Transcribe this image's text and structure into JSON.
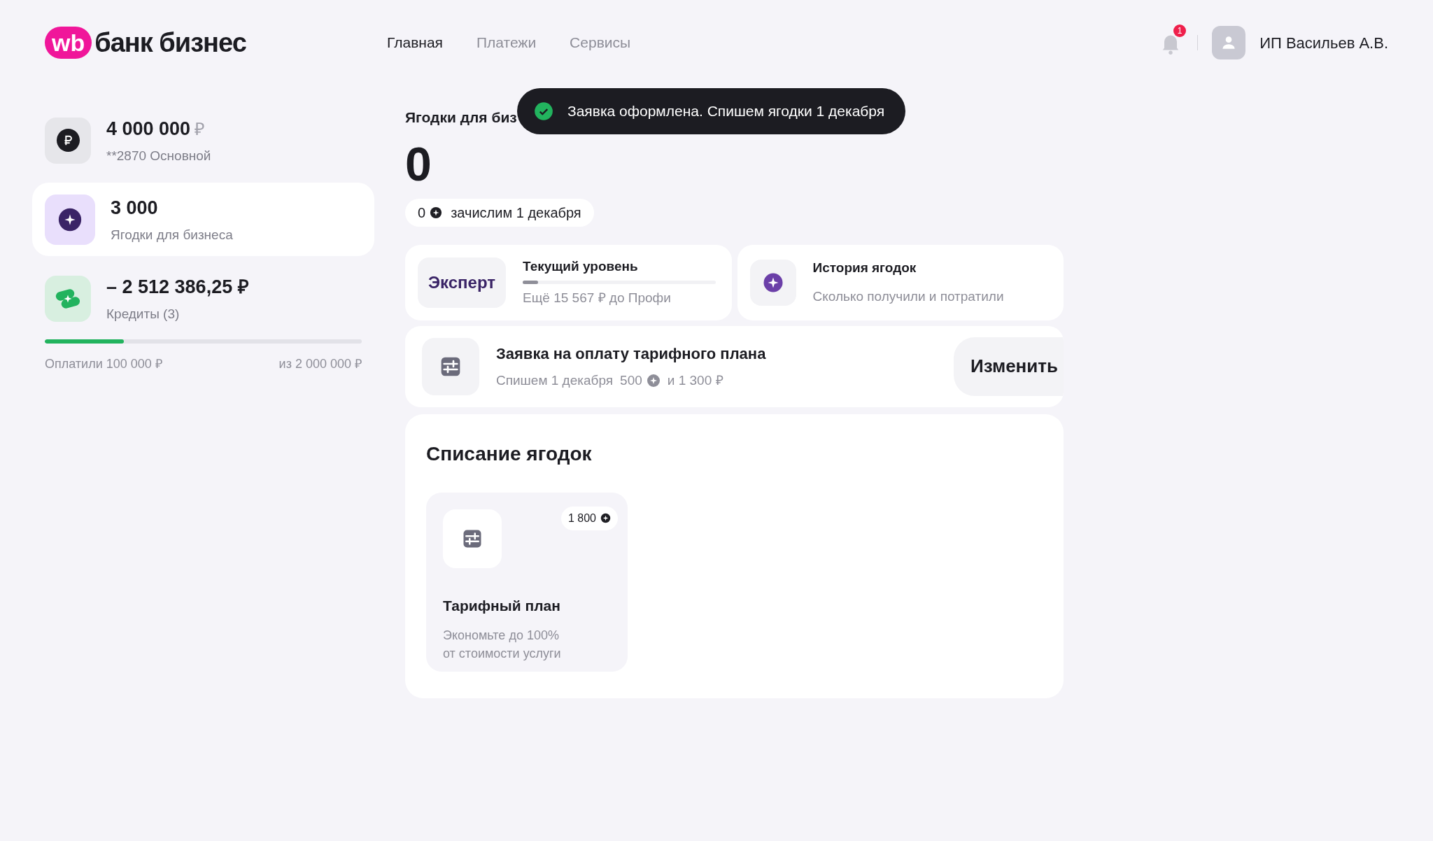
{
  "header": {
    "logo_badge": "wb",
    "logo_text": "банк бизнес",
    "nav": [
      {
        "label": "Главная",
        "selected": true
      },
      {
        "label": "Платежи",
        "selected": false
      },
      {
        "label": "Сервисы",
        "selected": false
      }
    ],
    "notifications": "1",
    "user": "ИП Васильев А.В."
  },
  "sidebar": {
    "accounts": [
      {
        "kind": "ruble",
        "amount": "4 000 000",
        "currency": "₽",
        "subtitle": "**2870 Основной",
        "selected": false
      },
      {
        "kind": "berries",
        "amount": "3 000",
        "subtitle": "Ягодки для бизнеса",
        "selected": true
      },
      {
        "kind": "credit",
        "amount": "– 2 512 386,25 ₽",
        "subtitle": "Кредиты (3)",
        "selected": false
      }
    ],
    "credit_progress": {
      "level": 0.25,
      "paid": "Оплатили 100 000 ₽",
      "total": "из 2 000 000 ₽"
    }
  },
  "toast": {
    "text": "Заявка оформлена. Спишем ягодки 1 декабря"
  },
  "balance": {
    "title": "Ягодки для биз",
    "value": "0",
    "pending_amount": "0",
    "pending_text": "зачислим 1 декабря"
  },
  "level_card": {
    "badge": "Эксперт",
    "title": "Текущий уровень",
    "level": 0.08,
    "subtitle": "Ещё 15 567 ₽ до Профи"
  },
  "history_card": {
    "title": "История ягодок",
    "subtitle": "Сколько получили и потратили"
  },
  "request": {
    "title": "Заявка на оплату тарифного плана",
    "subtitle_start": "Спишем 1 декабря",
    "berries": "500",
    "subtitle_end": "и 1 300 ₽",
    "button": "Изменить"
  },
  "spending": {
    "title": "Списание ягодок",
    "tiles": [
      {
        "price": "1 800",
        "title": "Тарифный план",
        "description": "Экономьте до 100%\nот стоимости услуги"
      }
    ]
  }
}
